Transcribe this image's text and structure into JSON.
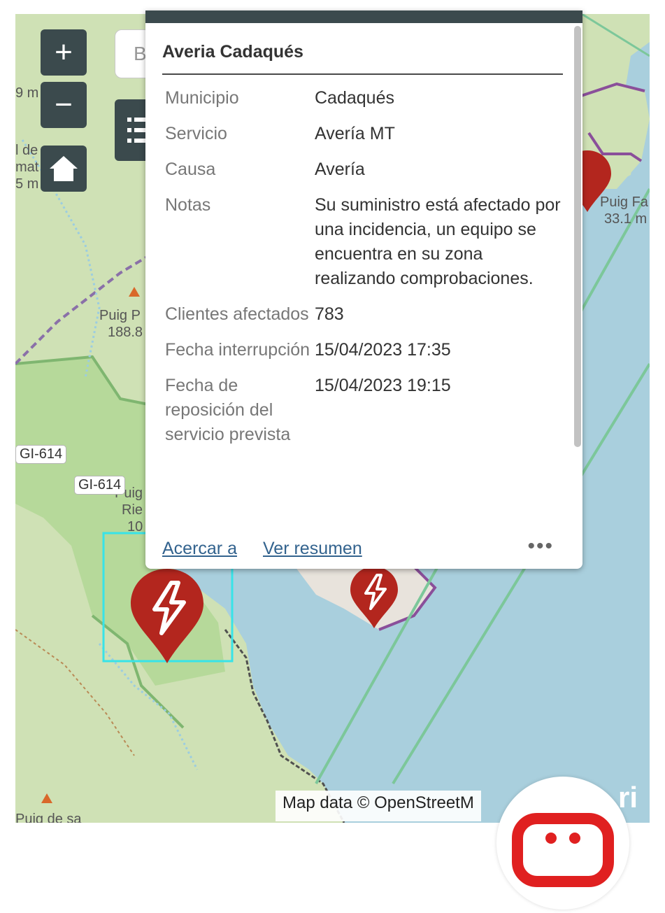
{
  "popup": {
    "title": "Averia Cadaqués",
    "fields": [
      {
        "key": "Municipio",
        "value": "Cadaqués"
      },
      {
        "key": "Servicio",
        "value": "Avería MT"
      },
      {
        "key": "Causa",
        "value": "Avería"
      },
      {
        "key": "Notas",
        "value": "Su suministro está afectado por una incidencia, un equipo se encuentra en su zona realizando comprobaciones."
      },
      {
        "key": "Clientes afectados",
        "value": "783"
      },
      {
        "key": "Fecha interrupción",
        "value": "15/04/2023 17:35"
      },
      {
        "key": "Fecha de reposición del servicio prevista",
        "value": "15/04/2023 19:15"
      }
    ],
    "actions": {
      "zoom_to": "Acercar a",
      "view_summary": "Ver resumen",
      "more": "•••"
    }
  },
  "controls": {
    "zoom_in": "+",
    "zoom_out": "−",
    "search_partial": "B"
  },
  "map": {
    "labels": {
      "l1": "9 m",
      "l2": "l de",
      "l3": "mat",
      "l4": "5 m",
      "puig_p": "Puig P",
      "puig_p_elev": "188.8",
      "puig_ri": "Puig",
      "puig_ri2": "Rie",
      "puig_ri3": "10",
      "puig_fa": "Puig Fa",
      "puig_fa_elev": "33.1 m",
      "bottom": "Puig de sa"
    },
    "roads": {
      "r1": "GI-614",
      "r2": "GI-614"
    },
    "attribution": "Map data © OpenStreetM",
    "esri_partial": "ri"
  },
  "colors": {
    "sea": "#a9cfdd",
    "land": "#cfe1b5",
    "marker": "#b3261e",
    "control": "#3b4a4d",
    "selection": "#37e3e8",
    "link": "#33638e"
  }
}
